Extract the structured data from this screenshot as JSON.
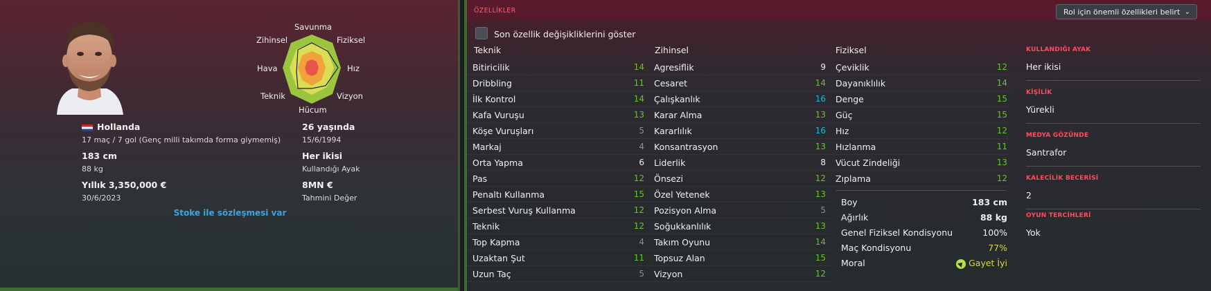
{
  "colors": {
    "val_white": "#f0f0f0",
    "val_green": "#68c22d",
    "val_grey": "#8d9092",
    "val_cyan": "#24b8d6",
    "val_yellow": "#d7d74a",
    "accent_red": "#ff4d5e",
    "link_blue": "#3da4e0"
  },
  "radar": {
    "labels": {
      "top": "Savunma",
      "top_left": "Zihinsel",
      "top_right": "Fiziksel",
      "left": "Hava",
      "right": "Hız",
      "bottom_left": "Teknik",
      "bottom_right": "Vizyon",
      "bottom": "Hücum"
    }
  },
  "bio": {
    "nationality": "Hollanda",
    "caps": "17 maç / 7 gol (Genç milli takımda forma giymemiş)",
    "height": "183 cm",
    "weight": "88 kg",
    "wage": "Yıllık 3,350,000 €",
    "contract_end": "30/6/2023",
    "age": "26 yaşında",
    "dob": "15/6/1994",
    "foot": "Her ikisi",
    "foot_label": "Kullandığı Ayak",
    "value": "8MN €",
    "value_label": "Tahmini Değer",
    "contract_status": "Stoke ile sözleşmesi var"
  },
  "attributes": {
    "section_title": "ÖZELLİKLER",
    "role_dropdown": "Rol için önemli özellikleri belirt",
    "show_changes": "Son özellik değişikliklerini göster",
    "teknik_title": "Teknik",
    "zihinsel_title": "Zihinsel",
    "fiziksel_title": "Fiziksel",
    "teknik": [
      {
        "name": "Bitiricilik",
        "value": "14",
        "tone": "green"
      },
      {
        "name": "Dribbling",
        "value": "11",
        "tone": "green"
      },
      {
        "name": "İlk Kontrol",
        "value": "14",
        "tone": "green"
      },
      {
        "name": "Kafa Vuruşu",
        "value": "13",
        "tone": "green"
      },
      {
        "name": "Köşe Vuruşları",
        "value": "5",
        "tone": "grey"
      },
      {
        "name": "Markaj",
        "value": "4",
        "tone": "grey"
      },
      {
        "name": "Orta Yapma",
        "value": "6",
        "tone": "white"
      },
      {
        "name": "Pas",
        "value": "12",
        "tone": "green"
      },
      {
        "name": "Penaltı Kullanma",
        "value": "15",
        "tone": "green"
      },
      {
        "name": "Serbest Vuruş Kullanma",
        "value": "12",
        "tone": "green"
      },
      {
        "name": "Teknik",
        "value": "12",
        "tone": "green"
      },
      {
        "name": "Top Kapma",
        "value": "4",
        "tone": "grey"
      },
      {
        "name": "Uzaktan Şut",
        "value": "11",
        "tone": "green"
      },
      {
        "name": "Uzun Taç",
        "value": "5",
        "tone": "grey"
      }
    ],
    "zihinsel": [
      {
        "name": "Agresiflik",
        "value": "9",
        "tone": "white"
      },
      {
        "name": "Cesaret",
        "value": "14",
        "tone": "green"
      },
      {
        "name": "Çalışkanlık",
        "value": "16",
        "tone": "cyan"
      },
      {
        "name": "Karar Alma",
        "value": "13",
        "tone": "green"
      },
      {
        "name": "Kararlılık",
        "value": "16",
        "tone": "cyan"
      },
      {
        "name": "Konsantrasyon",
        "value": "13",
        "tone": "green"
      },
      {
        "name": "Liderlik",
        "value": "8",
        "tone": "white"
      },
      {
        "name": "Önsezi",
        "value": "12",
        "tone": "green"
      },
      {
        "name": "Özel Yetenek",
        "value": "13",
        "tone": "green"
      },
      {
        "name": "Pozisyon Alma",
        "value": "5",
        "tone": "grey"
      },
      {
        "name": "Soğukkanlılık",
        "value": "13",
        "tone": "green"
      },
      {
        "name": "Takım Oyunu",
        "value": "14",
        "tone": "green"
      },
      {
        "name": "Topsuz Alan",
        "value": "15",
        "tone": "green"
      },
      {
        "name": "Vizyon",
        "value": "12",
        "tone": "green"
      }
    ],
    "fiziksel": [
      {
        "name": "Çeviklik",
        "value": "12",
        "tone": "green"
      },
      {
        "name": "Dayanıklılık",
        "value": "14",
        "tone": "green"
      },
      {
        "name": "Denge",
        "value": "15",
        "tone": "green"
      },
      {
        "name": "Güç",
        "value": "15",
        "tone": "green"
      },
      {
        "name": "Hız",
        "value": "12",
        "tone": "green"
      },
      {
        "name": "Hızlanma",
        "value": "11",
        "tone": "green"
      },
      {
        "name": "Vücut Zindeliği",
        "value": "13",
        "tone": "green"
      },
      {
        "name": "Zıplama",
        "value": "12",
        "tone": "green"
      }
    ],
    "physical_info": [
      {
        "name": "Boy",
        "value": "183 cm",
        "tone": "white_bold"
      },
      {
        "name": "Ağırlık",
        "value": "88 kg",
        "tone": "white_bold"
      },
      {
        "name": "Genel Fiziksel Kondisyonu",
        "value": "100%",
        "tone": "white"
      },
      {
        "name": "Maç Kondisyonu",
        "value": "77%",
        "tone": "yellow"
      },
      {
        "name": "Moral",
        "value": "Gayet İyi",
        "tone": "morale"
      }
    ]
  },
  "side_info": [
    {
      "label": "KULLANDIĞI AYAK",
      "value": "Her ikisi"
    },
    {
      "label": "KİŞİLİK",
      "value": "Yürekli"
    },
    {
      "label": "MEDYA GÖZÜNDE",
      "value": "Santrafor"
    },
    {
      "label": "KALECİLİK BECERİSİ",
      "value": "2"
    },
    {
      "label": "OYUN TERCİHLERİ",
      "value": "Yok"
    }
  ]
}
